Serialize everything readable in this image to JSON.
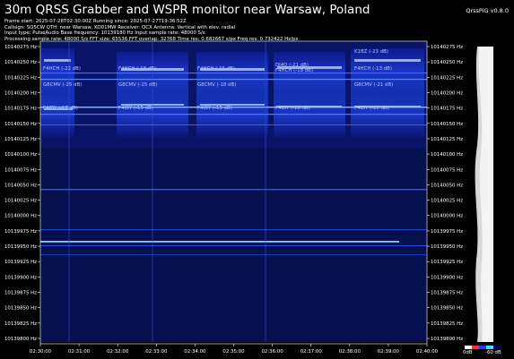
{
  "header": {
    "title": "30m QRSS Grabber and WSPR monitor near Warsaw, Poland",
    "version": "QrssPiG v0.8.0",
    "info_lines": [
      "Frame start: 2025-07-28T02:30:00Z Running since: 2025-07-27T19:36:52Z",
      "Callsign: SQ5CW QTH: near Warsaw, KO01MW Receiver: QCX Antenna: Vertical with elev. radial",
      "Input type: PulseAudio Base frequency: 10139180 Hz Input sample rate: 48000 S/s",
      "Processing sample rate: 48000 S/s FFT size: 65536 FFT overlap: 32768 Time res: 0.682667 s/px Freq res: 0.732422 Hz/px"
    ]
  },
  "waterfall": {
    "frequency_ticks_left": [
      "10140275 Hz",
      "10140250 Hz",
      "10140225 Hz",
      "10140200 Hz",
      "10140175 Hz",
      "10140150 Hz",
      "10140125 Hz",
      "10140100 Hz",
      "10140075 Hz",
      "10140050 Hz",
      "10140025 Hz",
      "10140000 Hz",
      "10139975 Hz",
      "10139950 Hz",
      "10139925 Hz",
      "10139900 Hz",
      "10139875 Hz",
      "10139850 Hz",
      "10139825 Hz",
      "10139800 Hz"
    ],
    "frequency_ticks_right": [
      "10140275 Hz",
      "10140250 Hz",
      "10140225 Hz",
      "10140200 Hz",
      "10140175 Hz",
      "10140150 Hz",
      "10140125 Hz",
      "10140100 Hz",
      "10140075 Hz",
      "10140050 Hz",
      "10140025 Hz",
      "10140000 Hz",
      "10139975 Hz",
      "10139950 Hz",
      "10139925 Hz",
      "10139900 Hz",
      "10139875 Hz",
      "10139850 Hz",
      "10139825 Hz",
      "10139800 Hz"
    ],
    "time_ticks": [
      "02:30:00",
      "02:31:00",
      "02:32:00",
      "02:33:00",
      "02:34:00",
      "02:35:00",
      "02:36:00",
      "02:37:00",
      "02:38:00",
      "02:39:00",
      "02:40:00"
    ],
    "wspr_labels": [
      {
        "text": "F4HCH (-22 dB)"
      },
      {
        "text": "G8CMV (-25 dB)"
      },
      {
        "text": "F4IDY (-17 dB)"
      },
      {
        "text": "F4HCH (-18 dB)"
      },
      {
        "text": "G8CMV (-25 dB)"
      },
      {
        "text": "F4IDY (-15 dB)"
      },
      {
        "text": "F4HCH (-15 dB)"
      },
      {
        "text": "G8CMV (-18 dB)"
      },
      {
        "text": "F4IDY (-15 dB)"
      },
      {
        "text": "DJ4Q (-21 dB)"
      },
      {
        "text": "F4HCH (-18 dB)"
      },
      {
        "text": "F4IDY (-18 dB)"
      },
      {
        "text": "K1BZ (-23 dB)"
      },
      {
        "text": "F4HCH (-13 dB)"
      },
      {
        "text": "G8CMV (-21 dB)"
      },
      {
        "text": "F4IDY (-20 dB)"
      }
    ]
  },
  "scale": {
    "max_label": "0dB",
    "min_label": "-60 dB"
  },
  "colors": {
    "background": "#000000",
    "signal_strong": "#7fd0ff",
    "signal_mid": "#2b5cff",
    "noise": "#0a1266"
  }
}
